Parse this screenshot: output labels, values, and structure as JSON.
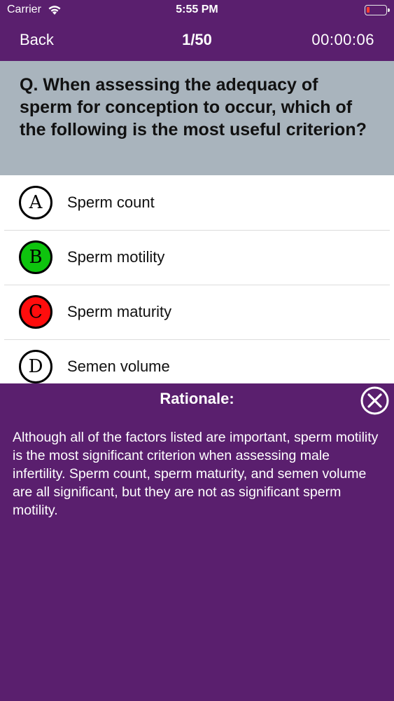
{
  "status_bar": {
    "carrier": "Carrier",
    "time": "5:55 PM",
    "icons": [
      "wifi-icon",
      "battery-icon"
    ]
  },
  "nav": {
    "back_label": "Back",
    "progress": "1/50",
    "timer": "00:00:06"
  },
  "question": {
    "text": "Q. When assessing the adequacy of sperm for conception to occur, which of the following is the most useful criterion?"
  },
  "options": [
    {
      "letter": "A",
      "label": "Sperm count",
      "state": "unselected",
      "color": "#ffffff"
    },
    {
      "letter": "B",
      "label": "Sperm motility",
      "state": "correct",
      "color": "#0ec40e"
    },
    {
      "letter": "C",
      "label": "Sperm maturity",
      "state": "incorrect",
      "color": "#ff0d0d"
    },
    {
      "letter": "D",
      "label": "Semen volume",
      "state": "unselected",
      "color": "#ffffff"
    }
  ],
  "rationale": {
    "title": "Rationale:",
    "body": "Although all of the factors listed are important, sperm motility is the most significant criterion when assessing male infertility. Sperm count, sperm maturity, and semen volume are all significant, but they are not as significant sperm motility.",
    "close_icon": "close-circle-icon"
  },
  "colors": {
    "primary": "#5a1f6e",
    "question_bg": "#a9b4bd",
    "correct": "#0ec40e",
    "incorrect": "#ff0d0d"
  }
}
